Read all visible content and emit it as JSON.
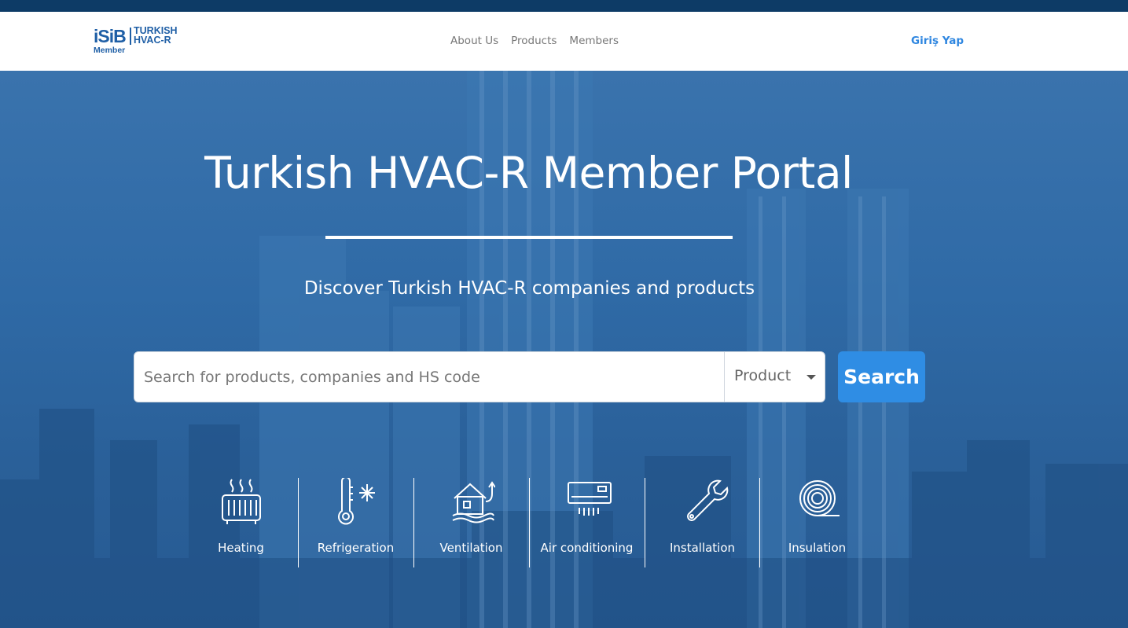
{
  "brand": {
    "logo_mark": "iSiB",
    "logo_text": "TURKISH\nHVAC-R",
    "logo_sub": "Member",
    "color": "#1f5fa6"
  },
  "nav": {
    "links": [
      "About Us",
      "Products",
      "Members"
    ],
    "login": "Giriş Yap"
  },
  "hero": {
    "title": "Turkish HVAC-R Member Portal",
    "subtitle": "Discover Turkish HVAC-R companies and products"
  },
  "search": {
    "placeholder": "Search for products, companies and HS code",
    "value": "",
    "type_selected": "Product",
    "button": "Search"
  },
  "categories": [
    {
      "label": "Heating",
      "icon": "radiator-icon"
    },
    {
      "label": "Refrigeration",
      "icon": "thermometer-snowflake-icon"
    },
    {
      "label": "Ventilation",
      "icon": "house-airflow-icon"
    },
    {
      "label": "Air conditioning",
      "icon": "air-conditioner-icon"
    },
    {
      "label": "Installation",
      "icon": "wrench-icon"
    },
    {
      "label": "Insulation",
      "icon": "insulation-roll-icon"
    }
  ],
  "colors": {
    "topbar": "#0d3b66",
    "hero_overlay": "#2f6aa6",
    "accent": "#2f8de4",
    "login": "#2e86e0"
  }
}
